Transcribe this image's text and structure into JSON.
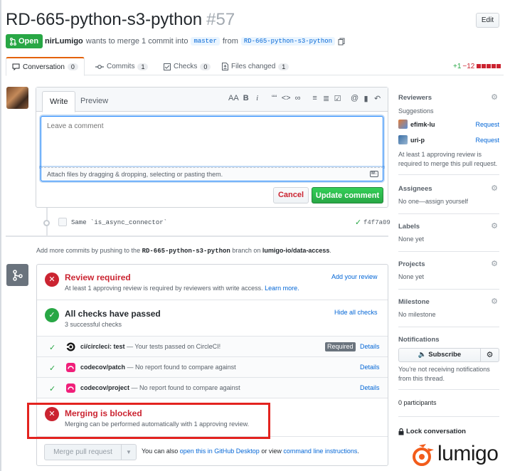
{
  "pr": {
    "title": "RD-665-python-s3-python",
    "number": "#57",
    "edit_label": "Edit",
    "state": "Open",
    "author": "nirLumigo",
    "meta_text": "wants to merge 1 commit into",
    "base_branch": "master",
    "from_text": "from",
    "head_branch": "RD-665-python-s3-python"
  },
  "tabs": [
    {
      "label": "Conversation",
      "count": "0"
    },
    {
      "label": "Commits",
      "count": "1"
    },
    {
      "label": "Checks",
      "count": "0"
    },
    {
      "label": "Files changed",
      "count": "1"
    }
  ],
  "diffstat": {
    "additions": "+1",
    "deletions": "−12"
  },
  "comment": {
    "tab_write": "Write",
    "tab_preview": "Preview",
    "toolbar": [
      "AA",
      "B",
      "i",
      "““",
      "<>",
      "∞",
      "≡",
      "≣",
      "☑",
      "@",
      "▮",
      "↶"
    ],
    "placeholder": "Leave a comment",
    "attach_text": "Attach files by dragging & dropping, selecting or pasting them.",
    "markdown_badge": "M↓",
    "cancel_label": "Cancel",
    "update_label": "Update comment"
  },
  "commit": {
    "message": "Same `is_async_connector`",
    "sha": "f4f7a09"
  },
  "push_note": {
    "prefix": "Add more commits by pushing to the",
    "branch": "RD-665-python-s3-python",
    "middle": "branch on",
    "repo": "lumigo-io/data-access",
    "suffix": "."
  },
  "merge": {
    "review_title": "Review required",
    "review_sub": "At least 1 approving review is required by reviewers with write access.",
    "review_learn": "Learn more.",
    "add_review": "Add your review",
    "checks_title": "All checks have passed",
    "checks_sub": "3 successful checks",
    "hide_checks": "Hide all checks",
    "checks": [
      {
        "name": "ci/circleci: test",
        "desc": "— Your tests passed on CircleCI!",
        "required": "Required",
        "details": "Details"
      },
      {
        "name": "codecov/patch",
        "desc": "— No report found to compare against",
        "required": "",
        "details": "Details"
      },
      {
        "name": "codecov/project",
        "desc": "— No report found to compare against",
        "required": "",
        "details": "Details"
      }
    ],
    "blocked_title": "Merging is blocked",
    "blocked_sub": "Merging can be performed automatically with 1 approving review.",
    "merge_button": "Merge pull request",
    "alt_prefix": "You can also",
    "alt_link1": "open this in GitHub Desktop",
    "alt_middle": "or view",
    "alt_link2": "command line instructions",
    "alt_suffix": "."
  },
  "sidebar": {
    "reviewers_title": "Reviewers",
    "suggestions": "Suggestions",
    "reviewers": [
      {
        "name": "efimk-lu",
        "action": "Request"
      },
      {
        "name": "uri-p",
        "action": "Request"
      }
    ],
    "review_note_1": "At least 1 approving review is",
    "review_note_2": "required to merge this pull request.",
    "assignees_title": "Assignees",
    "assignees_value": "No one—assign yourself",
    "labels_title": "Labels",
    "labels_value": "None yet",
    "projects_title": "Projects",
    "projects_value": "None yet",
    "milestone_title": "Milestone",
    "milestone_value": "No milestone",
    "notifications_title": "Notifications",
    "subscribe_label": "Subscribe",
    "notif_note_1": "You’re not receiving notifications",
    "notif_note_2": "from this thread.",
    "participants": "0 participants",
    "lock_label": "Lock conversation"
  },
  "logo": {
    "text": "lumigo",
    "color": "#f25c1b"
  },
  "colors": {
    "green": "#28a745",
    "red": "#cb2431",
    "link": "#0366d6",
    "highlight": "#e3231f"
  }
}
